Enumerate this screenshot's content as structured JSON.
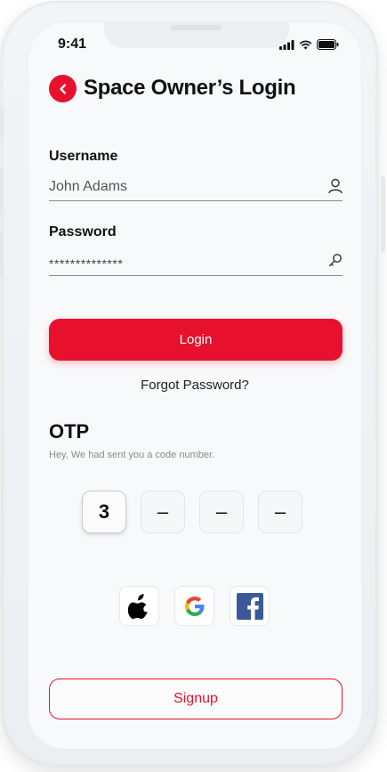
{
  "status_bar": {
    "time": "9:41"
  },
  "header": {
    "title": "Space Owner’s Login"
  },
  "username": {
    "label": "Username",
    "value": "John Adams"
  },
  "password": {
    "label": "Password",
    "value": "**************"
  },
  "actions": {
    "login_label": "Login",
    "forgot_label": "Forgot Password?",
    "signup_label": "Signup"
  },
  "otp": {
    "title": "OTP",
    "subtitle": "Hey, We had sent you a code number.",
    "digits": [
      "3",
      "–",
      "–",
      "–"
    ]
  },
  "social": {
    "google_letter": "G",
    "facebook_letter": "f"
  },
  "colors": {
    "accent": "#e8112d",
    "facebook": "#3b5998"
  },
  "icons": [
    "chevron-left-icon",
    "user-icon",
    "key-icon",
    "apple-icon",
    "google-icon",
    "facebook-icon",
    "signal-icon",
    "wifi-icon",
    "battery-icon"
  ]
}
